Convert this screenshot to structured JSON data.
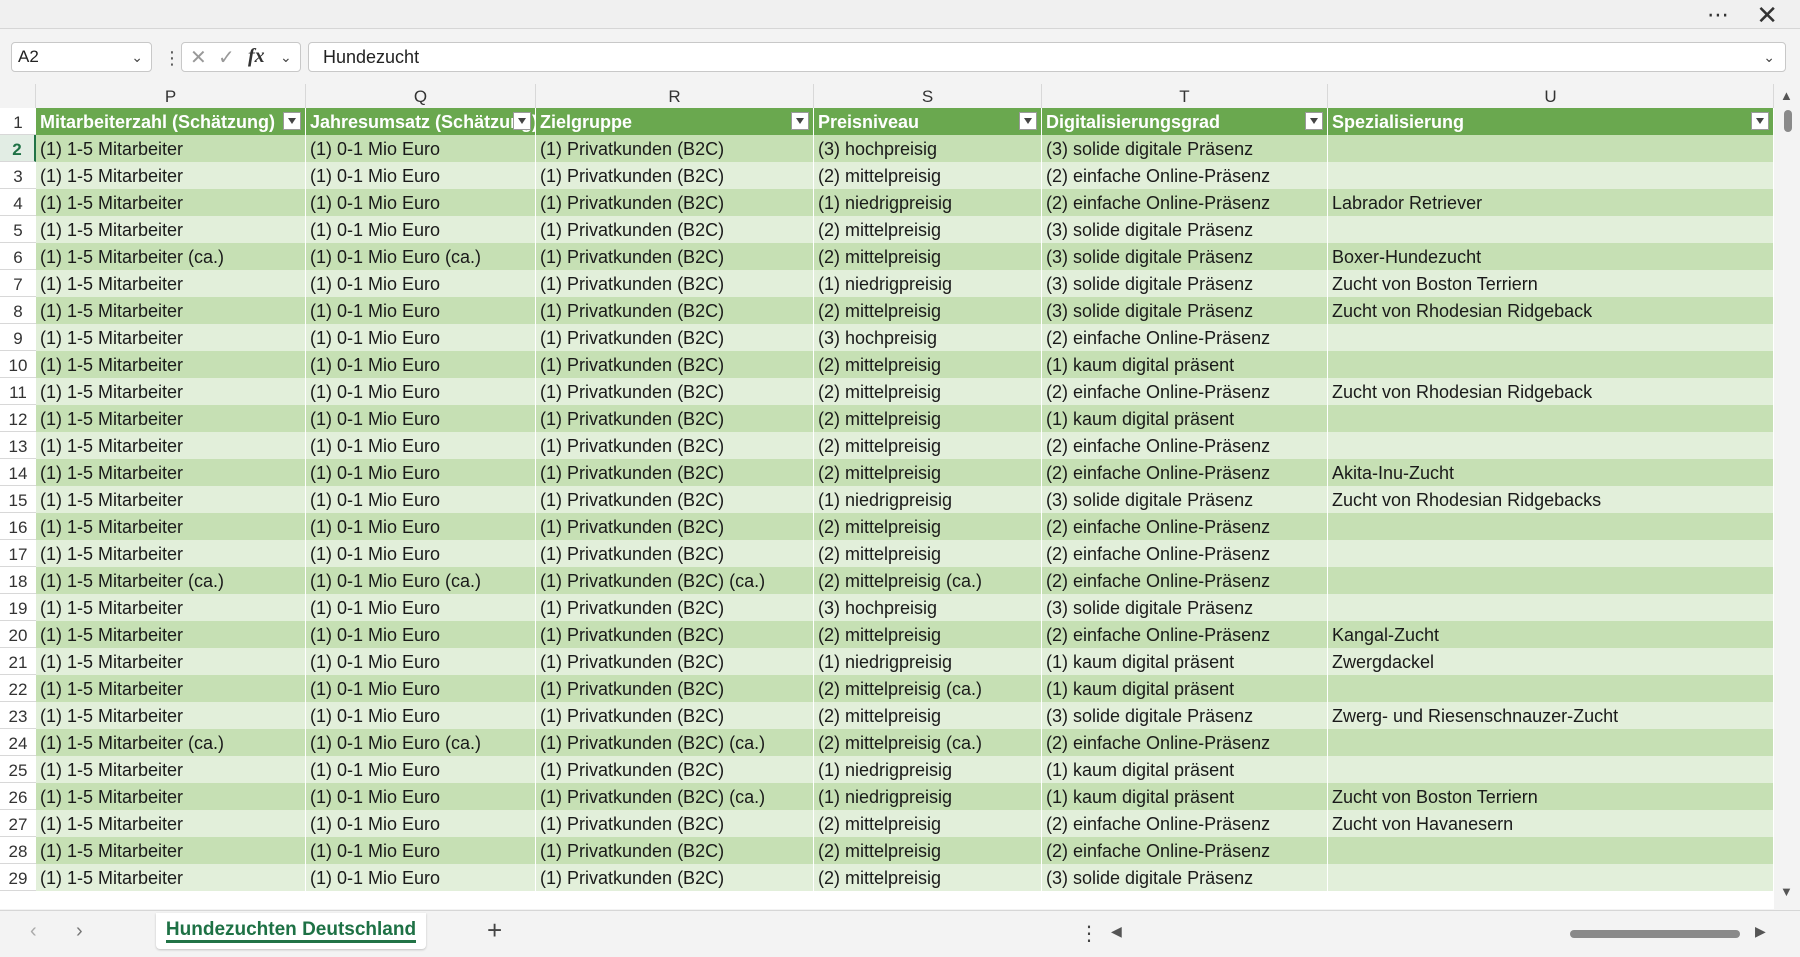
{
  "window": {
    "more_icon": "⋯",
    "close_icon": "✕"
  },
  "formula_bar": {
    "name_box": "A2",
    "formula": "Hundezucht"
  },
  "columns": [
    "P",
    "Q",
    "R",
    "S",
    "T",
    "U"
  ],
  "header_row_number": "1",
  "headers": [
    "Mitarbeiterzahl (Schätzung)",
    "Jahresumsatz (Schätzung)",
    "Zielgruppe",
    "Preisniveau",
    "Digitalisierungsgrad",
    "Spezialisierung"
  ],
  "rows": [
    {
      "num": "2",
      "cells": [
        "(1) 1-5 Mitarbeiter",
        "(1) 0-1 Mio Euro",
        "(1) Privatkunden (B2C)",
        "(3) hochpreisig",
        "(3) solide digitale Präsenz",
        ""
      ]
    },
    {
      "num": "3",
      "cells": [
        "(1) 1-5 Mitarbeiter",
        "(1) 0-1 Mio Euro",
        "(1) Privatkunden (B2C)",
        "(2) mittelpreisig",
        "(2) einfache Online-Präsenz",
        ""
      ]
    },
    {
      "num": "4",
      "cells": [
        "(1) 1-5 Mitarbeiter",
        "(1) 0-1 Mio Euro",
        "(1) Privatkunden (B2C)",
        "(1) niedrigpreisig",
        "(2) einfache Online-Präsenz",
        "Labrador Retriever"
      ]
    },
    {
      "num": "5",
      "cells": [
        "(1) 1-5 Mitarbeiter",
        "(1) 0-1 Mio Euro",
        "(1) Privatkunden (B2C)",
        "(2) mittelpreisig",
        "(3) solide digitale Präsenz",
        ""
      ]
    },
    {
      "num": "6",
      "cells": [
        "(1) 1-5 Mitarbeiter (ca.)",
        "(1) 0-1 Mio Euro (ca.)",
        "(1) Privatkunden (B2C)",
        "(2) mittelpreisig",
        "(3) solide digitale Präsenz",
        "Boxer-Hundezucht"
      ]
    },
    {
      "num": "7",
      "cells": [
        "(1) 1-5 Mitarbeiter",
        "(1) 0-1 Mio Euro",
        "(1) Privatkunden (B2C)",
        "(1) niedrigpreisig",
        "(3) solide digitale Präsenz",
        "Zucht von Boston Terriern"
      ]
    },
    {
      "num": "8",
      "cells": [
        "(1) 1-5 Mitarbeiter",
        "(1) 0-1 Mio Euro",
        "(1) Privatkunden (B2C)",
        "(2) mittelpreisig",
        "(3) solide digitale Präsenz",
        "Zucht von Rhodesian Ridgeback"
      ]
    },
    {
      "num": "9",
      "cells": [
        "(1) 1-5 Mitarbeiter",
        "(1) 0-1 Mio Euro",
        "(1) Privatkunden (B2C)",
        "(3) hochpreisig",
        "(2) einfache Online-Präsenz",
        ""
      ]
    },
    {
      "num": "10",
      "cells": [
        "(1) 1-5 Mitarbeiter",
        "(1) 0-1 Mio Euro",
        "(1) Privatkunden (B2C)",
        "(2) mittelpreisig",
        "(1) kaum digital präsent",
        ""
      ]
    },
    {
      "num": "11",
      "cells": [
        "(1) 1-5 Mitarbeiter",
        "(1) 0-1 Mio Euro",
        "(1) Privatkunden (B2C)",
        "(2) mittelpreisig",
        "(2) einfache Online-Präsenz",
        "Zucht von Rhodesian Ridgeback"
      ]
    },
    {
      "num": "12",
      "cells": [
        "(1) 1-5 Mitarbeiter",
        "(1) 0-1 Mio Euro",
        "(1) Privatkunden (B2C)",
        "(2) mittelpreisig",
        "(1) kaum digital präsent",
        ""
      ]
    },
    {
      "num": "13",
      "cells": [
        "(1) 1-5 Mitarbeiter",
        "(1) 0-1 Mio Euro",
        "(1) Privatkunden (B2C)",
        "(2) mittelpreisig",
        "(2) einfache Online-Präsenz",
        ""
      ]
    },
    {
      "num": "14",
      "cells": [
        "(1) 1-5 Mitarbeiter",
        "(1) 0-1 Mio Euro",
        "(1) Privatkunden (B2C)",
        "(2) mittelpreisig",
        "(2) einfache Online-Präsenz",
        "Akita-Inu-Zucht"
      ]
    },
    {
      "num": "15",
      "cells": [
        "(1) 1-5 Mitarbeiter",
        "(1) 0-1 Mio Euro",
        "(1) Privatkunden (B2C)",
        "(1) niedrigpreisig",
        "(3) solide digitale Präsenz",
        "Zucht von Rhodesian Ridgebacks"
      ]
    },
    {
      "num": "16",
      "cells": [
        "(1) 1-5 Mitarbeiter",
        "(1) 0-1 Mio Euro",
        "(1) Privatkunden (B2C)",
        "(2) mittelpreisig",
        "(2) einfache Online-Präsenz",
        ""
      ]
    },
    {
      "num": "17",
      "cells": [
        "(1) 1-5 Mitarbeiter",
        "(1) 0-1 Mio Euro",
        "(1) Privatkunden (B2C)",
        "(2) mittelpreisig",
        "(2) einfache Online-Präsenz",
        ""
      ]
    },
    {
      "num": "18",
      "cells": [
        "(1) 1-5 Mitarbeiter (ca.)",
        "(1) 0-1 Mio Euro (ca.)",
        "(1) Privatkunden (B2C) (ca.)",
        "(2) mittelpreisig (ca.)",
        "(2) einfache Online-Präsenz",
        ""
      ]
    },
    {
      "num": "19",
      "cells": [
        "(1) 1-5 Mitarbeiter",
        "(1) 0-1 Mio Euro",
        "(1) Privatkunden (B2C)",
        "(3) hochpreisig",
        "(3) solide digitale Präsenz",
        ""
      ]
    },
    {
      "num": "20",
      "cells": [
        "(1) 1-5 Mitarbeiter",
        "(1) 0-1 Mio Euro",
        "(1) Privatkunden (B2C)",
        "(2) mittelpreisig",
        "(2) einfache Online-Präsenz",
        "Kangal-Zucht"
      ]
    },
    {
      "num": "21",
      "cells": [
        "(1) 1-5 Mitarbeiter",
        "(1) 0-1 Mio Euro",
        "(1) Privatkunden (B2C)",
        "(1) niedrigpreisig",
        "(1) kaum digital präsent",
        "Zwergdackel"
      ]
    },
    {
      "num": "22",
      "cells": [
        "(1) 1-5 Mitarbeiter",
        "(1) 0-1 Mio Euro",
        "(1) Privatkunden (B2C)",
        "(2) mittelpreisig (ca.)",
        "(1) kaum digital präsent",
        ""
      ]
    },
    {
      "num": "23",
      "cells": [
        "(1) 1-5 Mitarbeiter",
        "(1) 0-1 Mio Euro",
        "(1) Privatkunden (B2C)",
        "(2) mittelpreisig",
        "(3) solide digitale Präsenz",
        "Zwerg- und Riesenschnauzer-Zucht"
      ]
    },
    {
      "num": "24",
      "cells": [
        "(1) 1-5 Mitarbeiter (ca.)",
        "(1) 0-1 Mio Euro (ca.)",
        "(1) Privatkunden (B2C) (ca.)",
        "(2) mittelpreisig (ca.)",
        "(2) einfache Online-Präsenz",
        ""
      ]
    },
    {
      "num": "25",
      "cells": [
        "(1) 1-5 Mitarbeiter",
        "(1) 0-1 Mio Euro",
        "(1) Privatkunden (B2C)",
        "(1) niedrigpreisig",
        "(1) kaum digital präsent",
        ""
      ]
    },
    {
      "num": "26",
      "cells": [
        "(1) 1-5 Mitarbeiter",
        "(1) 0-1 Mio Euro",
        "(1) Privatkunden (B2C) (ca.)",
        "(1) niedrigpreisig",
        "(1) kaum digital präsent",
        "Zucht von Boston Terriern"
      ]
    },
    {
      "num": "27",
      "cells": [
        "(1) 1-5 Mitarbeiter",
        "(1) 0-1 Mio Euro",
        "(1) Privatkunden (B2C)",
        "(2) mittelpreisig",
        "(2) einfache Online-Präsenz",
        "Zucht von Havanesern"
      ]
    },
    {
      "num": "28",
      "cells": [
        "(1) 1-5 Mitarbeiter",
        "(1) 0-1 Mio Euro",
        "(1) Privatkunden (B2C)",
        "(2) mittelpreisig",
        "(2) einfache Online-Präsenz",
        ""
      ]
    },
    {
      "num": "29",
      "cells": [
        "(1) 1-5 Mitarbeiter",
        "(1) 0-1 Mio Euro",
        "(1) Privatkunden (B2C)",
        "(2) mittelpreisig",
        "(3) solide digitale Präsenz",
        ""
      ]
    }
  ],
  "sheet_tab": {
    "label": "Hundezuchten Deutschland"
  },
  "colors": {
    "header_green": "#6aa84f",
    "band_dark": "#c6e0b4",
    "band_light": "#e2efda",
    "accent": "#217346"
  }
}
